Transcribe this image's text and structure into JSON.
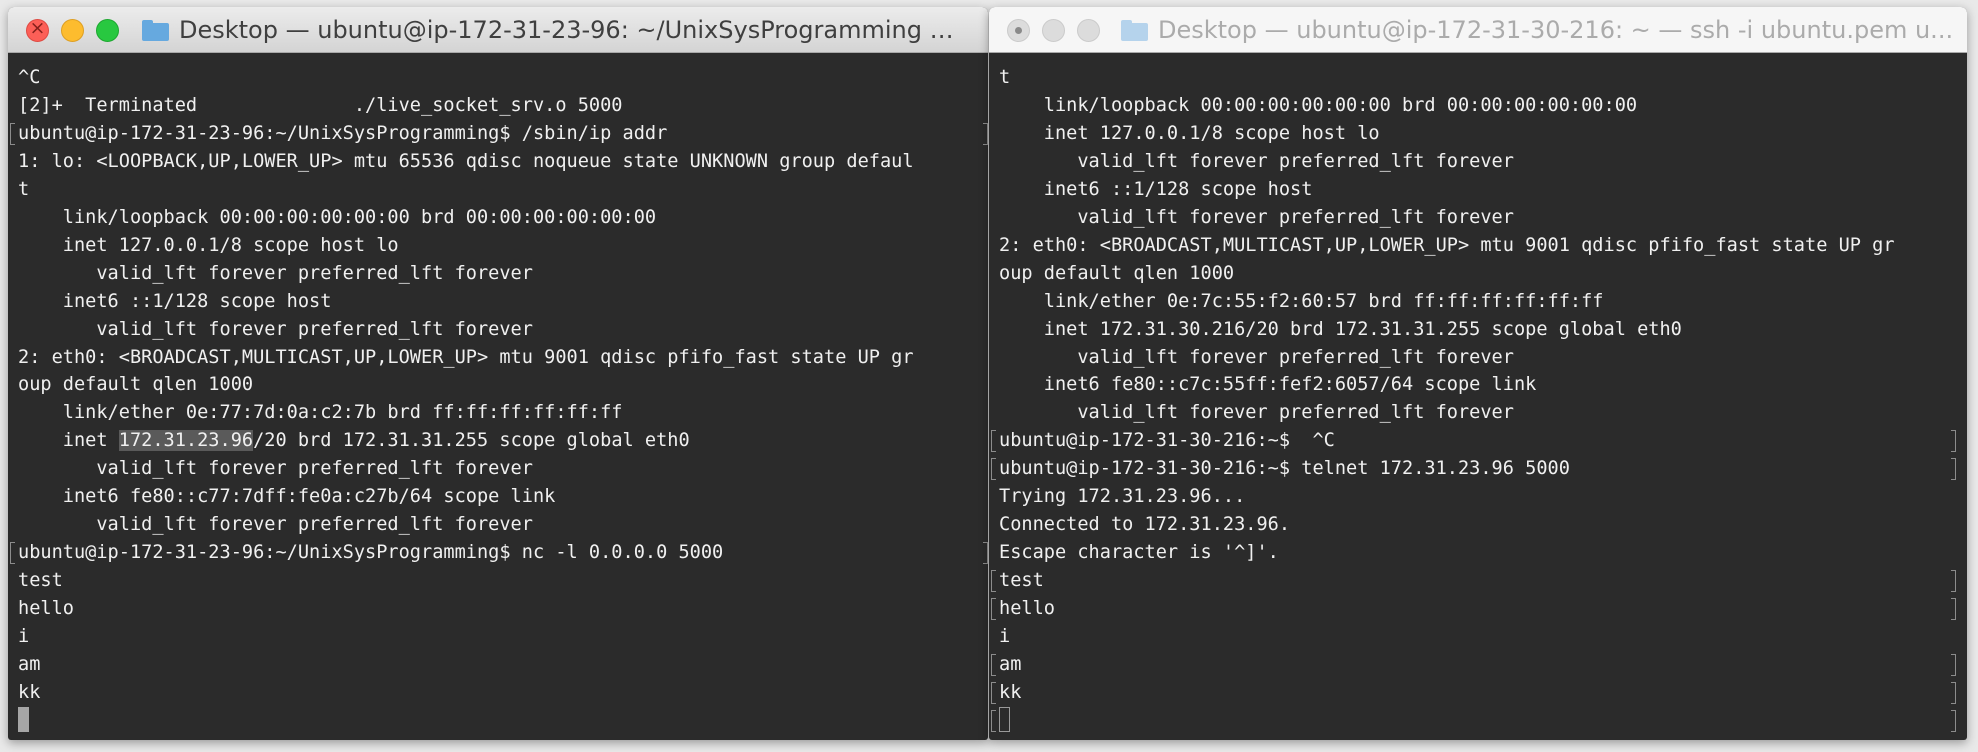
{
  "left_window": {
    "title": "Desktop — ubuntu@ip-172-31-23-96: ~/UnixSysProgramming —...",
    "state": "active",
    "lines": [
      {
        "text": "^C"
      },
      {
        "text": "[2]+  Terminated              ./live_socket_srv.o 5000"
      },
      {
        "text": "ubuntu@ip-172-31-23-96:~/UnixSysProgramming$ /sbin/ip addr",
        "mark": true
      },
      {
        "text": "1: lo: <LOOPBACK,UP,LOWER_UP> mtu 65536 qdisc noqueue state UNKNOWN group defaul"
      },
      {
        "text": "t"
      },
      {
        "text": "    link/loopback 00:00:00:00:00:00 brd 00:00:00:00:00:00"
      },
      {
        "text": "    inet 127.0.0.1/8 scope host lo"
      },
      {
        "text": "       valid_lft forever preferred_lft forever"
      },
      {
        "text": "    inet6 ::1/128 scope host"
      },
      {
        "text": "       valid_lft forever preferred_lft forever"
      },
      {
        "text": "2: eth0: <BROADCAST,MULTICAST,UP,LOWER_UP> mtu 9001 qdisc pfifo_fast state UP gr"
      },
      {
        "text": "oup default qlen 1000"
      },
      {
        "text": "    link/ether 0e:77:7d:0a:c2:7b brd ff:ff:ff:ff:ff:ff"
      },
      {
        "text": "    inet 172.31.23.96/20 brd 172.31.31.255 scope global eth0",
        "highlight": "172.31.23.96"
      },
      {
        "text": "       valid_lft forever preferred_lft forever"
      },
      {
        "text": "    inet6 fe80::c77:7dff:fe0a:c27b/64 scope link"
      },
      {
        "text": "       valid_lft forever preferred_lft forever"
      },
      {
        "text": "ubuntu@ip-172-31-23-96:~/UnixSysProgramming$ nc -l 0.0.0.0 5000",
        "mark": true
      },
      {
        "text": "test"
      },
      {
        "text": "hello"
      },
      {
        "text": "i"
      },
      {
        "text": "am"
      },
      {
        "text": "kk"
      }
    ],
    "cursor": "solid"
  },
  "right_window": {
    "title": "Desktop — ubuntu@ip-172-31-30-216: ~ — ssh -i ubuntu.pem u...",
    "state": "inactive",
    "lines": [
      {
        "text": "t"
      },
      {
        "text": "    link/loopback 00:00:00:00:00:00 brd 00:00:00:00:00:00"
      },
      {
        "text": "    inet 127.0.0.1/8 scope host lo"
      },
      {
        "text": "       valid_lft forever preferred_lft forever"
      },
      {
        "text": "    inet6 ::1/128 scope host"
      },
      {
        "text": "       valid_lft forever preferred_lft forever"
      },
      {
        "text": "2: eth0: <BROADCAST,MULTICAST,UP,LOWER_UP> mtu 9001 qdisc pfifo_fast state UP gr"
      },
      {
        "text": "oup default qlen 1000"
      },
      {
        "text": "    link/ether 0e:7c:55:f2:60:57 brd ff:ff:ff:ff:ff:ff"
      },
      {
        "text": "    inet 172.31.30.216/20 brd 172.31.31.255 scope global eth0"
      },
      {
        "text": "       valid_lft forever preferred_lft forever"
      },
      {
        "text": "    inet6 fe80::c7c:55ff:fef2:6057/64 scope link"
      },
      {
        "text": "       valid_lft forever preferred_lft forever"
      },
      {
        "text": "ubuntu@ip-172-31-30-216:~$  ^C",
        "mark": true
      },
      {
        "text": "ubuntu@ip-172-31-30-216:~$ telnet 172.31.23.96 5000",
        "mark": true
      },
      {
        "text": "Trying 172.31.23.96..."
      },
      {
        "text": "Connected to 172.31.23.96."
      },
      {
        "text": "Escape character is '^]'."
      },
      {
        "text": "test",
        "mark": true
      },
      {
        "text": "hello",
        "mark": true
      },
      {
        "text": "i"
      },
      {
        "text": "am",
        "mark": true
      },
      {
        "text": "kk",
        "mark": true
      }
    ],
    "cursor": "outline"
  },
  "colors": {
    "terminal_bg": "#2b2b2b",
    "terminal_fg": "#f0f0f0",
    "selection": "#5a5a5a",
    "close": "#fc5f57",
    "minimize": "#fdbc2e",
    "zoom": "#28c840"
  },
  "icons": [
    "close-button-icon",
    "minimize-button-icon",
    "zoom-button-icon",
    "folder-icon"
  ]
}
